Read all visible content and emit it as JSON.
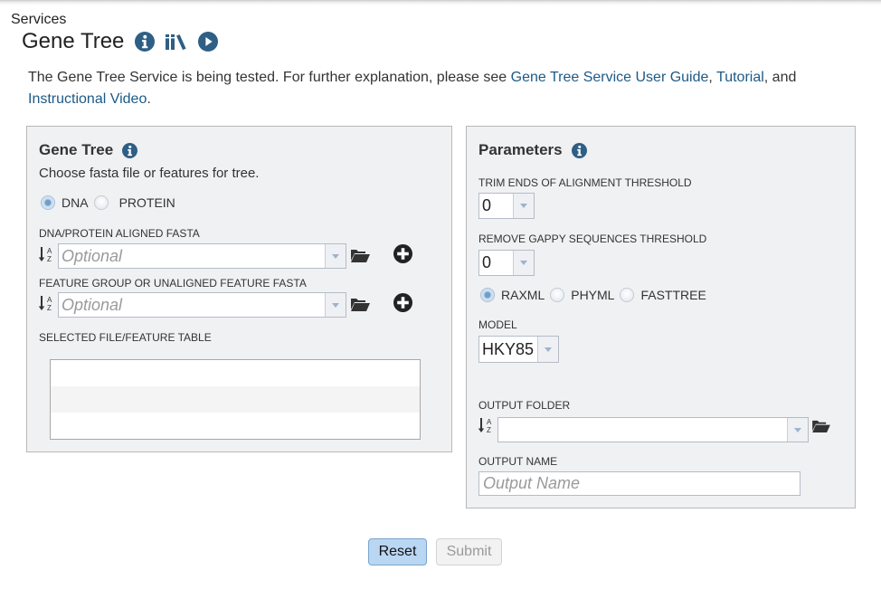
{
  "header": {
    "breadcrumb": "Services",
    "title": "Gene Tree",
    "icons": [
      "info-icon",
      "books-icon",
      "play-icon"
    ]
  },
  "intro": {
    "text_before": "The Gene Tree Service is being tested. For further explanation, please see ",
    "link_user_guide": "Gene Tree Service User Guide",
    "sep1": ", ",
    "link_tutorial": "Tutorial",
    "sep2": ", and ",
    "link_video": "Instructional Video",
    "end": "."
  },
  "gene_tree_panel": {
    "title": "Gene Tree",
    "subtitle": "Choose fasta file or features for tree.",
    "sequence_type": {
      "options": [
        "DNA",
        "PROTEIN"
      ],
      "selected": "DNA"
    },
    "aligned_fasta": {
      "label": "DNA/PROTEIN ALIGNED FASTA",
      "value": "",
      "placeholder": "Optional"
    },
    "unaligned_fasta": {
      "label": "FEATURE GROUP OR UNALIGNED FEATURE FASTA",
      "value": "",
      "placeholder": "Optional"
    },
    "selected_table": {
      "label": "SELECTED FILE/FEATURE TABLE",
      "rows": []
    }
  },
  "parameters_panel": {
    "title": "Parameters",
    "trim_threshold": {
      "label": "TRIM ENDS OF ALIGNMENT THRESHOLD",
      "value": "0"
    },
    "gappy_threshold": {
      "label": "REMOVE GAPPY SEQUENCES THRESHOLD",
      "value": "0"
    },
    "program": {
      "options": [
        "RAXML",
        "PHYML",
        "FASTTREE"
      ],
      "selected": "RAXML"
    },
    "model": {
      "label": "MODEL",
      "value": "HKY85"
    },
    "output_folder": {
      "label": "OUTPUT FOLDER",
      "value": ""
    },
    "output_name": {
      "label": "OUTPUT NAME",
      "value": "",
      "placeholder": "Output Name"
    }
  },
  "actions": {
    "reset_label": "Reset",
    "submit_label": "Submit",
    "submit_enabled": false
  },
  "colors": {
    "link": "#1d5a86",
    "icon": "#2e5f85",
    "panel_bg": "#f0f1f3",
    "reset_bg": "#b9d6f2"
  }
}
